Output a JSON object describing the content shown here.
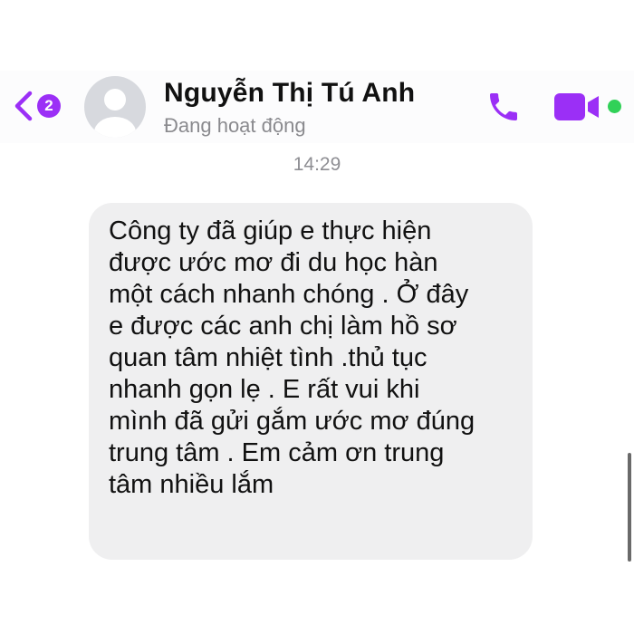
{
  "header": {
    "unread_count": "2",
    "contact_name": "Nguyễn Thị Tú Anh",
    "status": "Đang hoạt động",
    "back_icon": "chevron-left-icon",
    "call_icon": "phone-icon",
    "video_icon": "video-camera-icon",
    "avatar_icon": "default-person-icon"
  },
  "conversation": {
    "timestamp": "14:29",
    "messages": [
      {
        "text": "Công ty đã giúp e thực hiện\nđược ước mơ đi du học hàn\nmột cách nhanh chóng . Ở đây\ne được các anh chị làm hồ sơ\nquan tâm nhiệt tình .thủ tục\nnhanh gọn lẹ . E rất vui khi\nmình đã gửi gắm ước mơ đúng\ntrung tâm . Em cảm ơn trung\ntâm nhiều lắm"
      }
    ]
  },
  "colors": {
    "accent": "#9b2ff6",
    "online": "#31d158",
    "bubble": "#efeff0",
    "status_text": "#8a8a8e"
  }
}
